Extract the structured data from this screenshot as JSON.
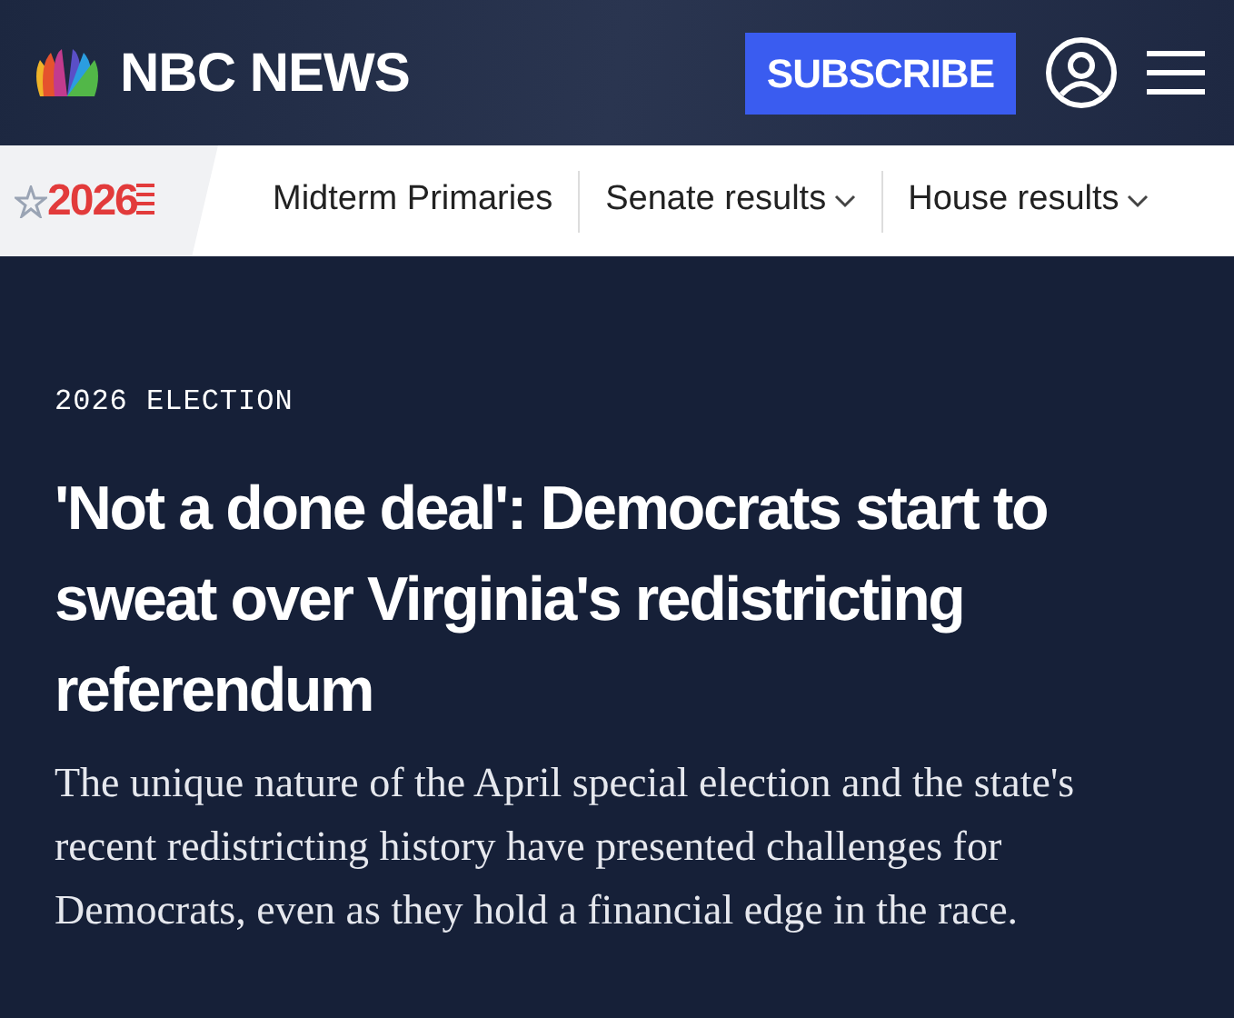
{
  "header": {
    "logo_text": "NBC NEWS",
    "subscribe_button": "SUBSCRIBE"
  },
  "nav": {
    "badge": "2026",
    "items": [
      {
        "label": "Midterm Primaries",
        "dropdown": false
      },
      {
        "label": "Senate results",
        "dropdown": true
      },
      {
        "label": "House results",
        "dropdown": true
      }
    ]
  },
  "article": {
    "kicker": "2026 ELECTION",
    "headline": "'Not a done deal': Democrats start to sweat over Virginia's redistricting referendum",
    "dek": "The unique nature of the April special election and the state's recent redistricting history have presented challenges for Democrats, even as they hold a financial edge in the race."
  }
}
